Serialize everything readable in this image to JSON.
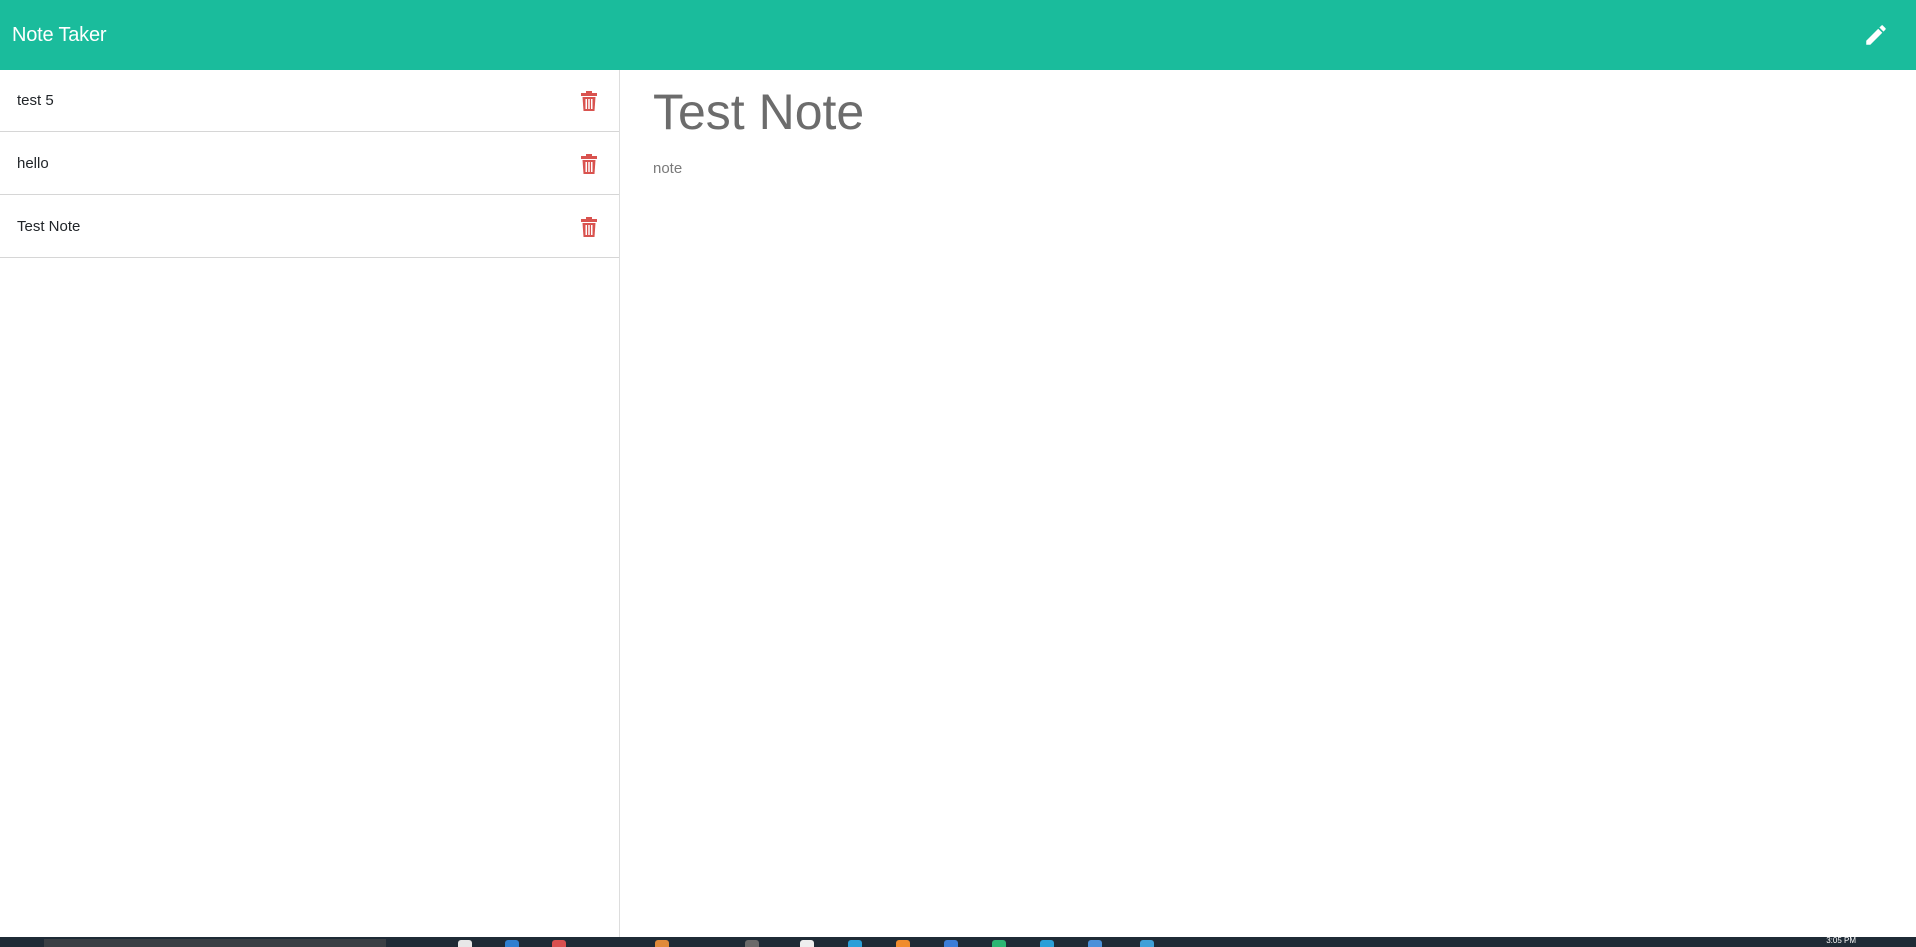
{
  "app": {
    "title": "Note Taker",
    "accent_color": "#1abc9c",
    "new_note_icon": "pencil-icon"
  },
  "notes": [
    {
      "title": "test 5"
    },
    {
      "title": "hello"
    },
    {
      "title": "Test Note"
    }
  ],
  "delete_icon": "trash-icon",
  "delete_color": "#d9534f",
  "active_note": {
    "title": "Test Note",
    "text": "note"
  },
  "taskbar": {
    "clock": "3:05 PM"
  }
}
